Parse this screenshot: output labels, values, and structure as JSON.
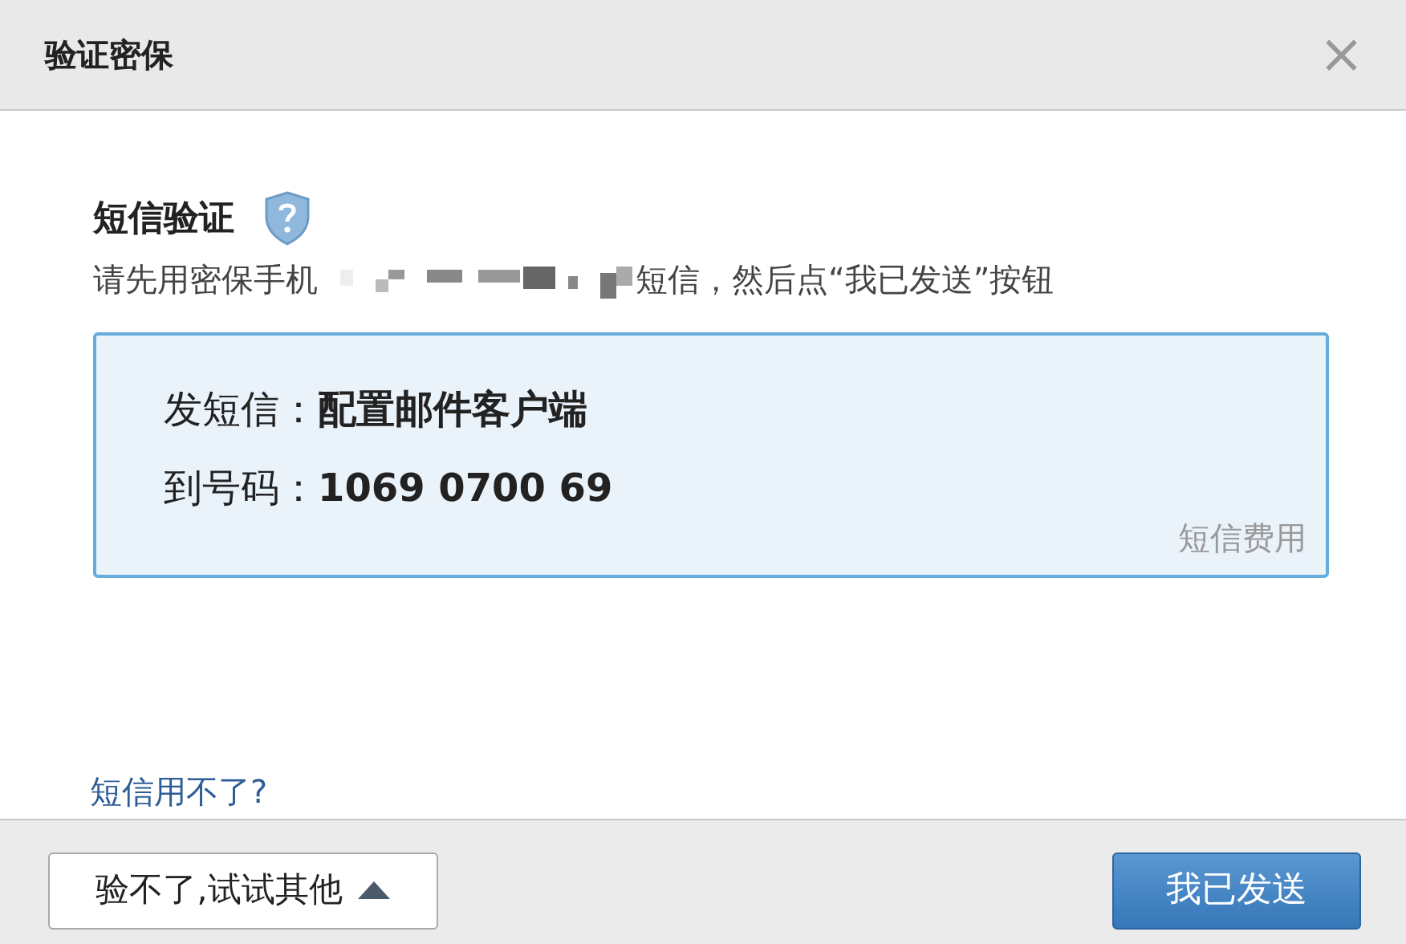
{
  "window": {
    "title": "验证密保",
    "close": "×"
  },
  "section": {
    "title": "短信验证",
    "instruction_before": "请先用密保手机",
    "instruction_after": "短信，然后点“我已发送”按钮"
  },
  "sms_box": {
    "rows": [
      {
        "label": "发短信：",
        "value": "配置邮件客户端"
      },
      {
        "label": "到号码：",
        "value": "1069 0700 69"
      }
    ],
    "fee_link": "短信费用"
  },
  "help_link": "短信用不了?",
  "footer": {
    "other_button": "验不了,试试其他",
    "confirm_button": "我已发送"
  }
}
